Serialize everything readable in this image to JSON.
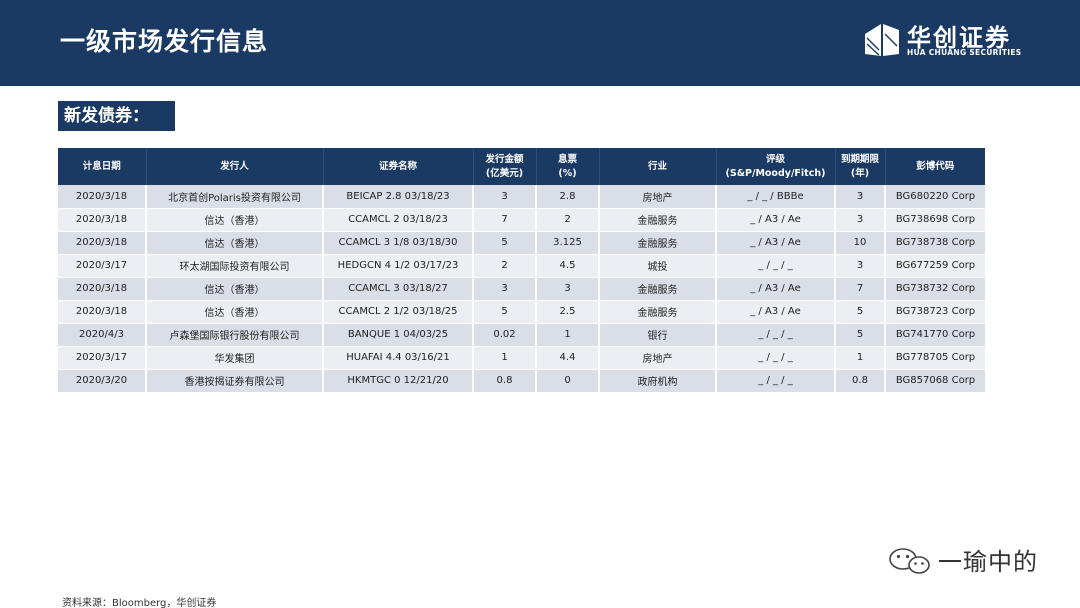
{
  "header": {
    "title": "一级市场发行信息",
    "logo_cn": "华创证券",
    "logo_en": "HUA CHUANG SECURITIES"
  },
  "section": {
    "label": "新发债券："
  },
  "table": {
    "headers": [
      [
        "计息日期"
      ],
      [
        "发行人"
      ],
      [
        "证券名称"
      ],
      [
        "发行金额",
        "(亿美元)"
      ],
      [
        "息票",
        "(%)"
      ],
      [
        "行业"
      ],
      [
        "评级",
        "(S&P/Moody/Fitch)"
      ],
      [
        "到期期限",
        "(年)"
      ],
      [
        "彭博代码"
      ]
    ],
    "rows": [
      [
        "2020/3/18",
        "北京首创Polaris投资有限公司",
        "BEICAP 2.8 03/18/23",
        "3",
        "2.8",
        "房地产",
        "_ / _ / BBBe",
        "3",
        "BG680220 Corp"
      ],
      [
        "2020/3/18",
        "信达（香港）",
        "CCAMCL 2 03/18/23",
        "7",
        "2",
        "金融服务",
        "_ / A3 / Ae",
        "3",
        "BG738698 Corp"
      ],
      [
        "2020/3/18",
        "信达（香港）",
        "CCAMCL 3 1/8 03/18/30",
        "5",
        "3.125",
        "金融服务",
        "_ / A3 / Ae",
        "10",
        "BG738738 Corp"
      ],
      [
        "2020/3/17",
        "环太湖国际投资有限公司",
        "HEDGCN 4 1/2 03/17/23",
        "2",
        "4.5",
        "城投",
        "_ / _ / _",
        "3",
        "BG677259 Corp"
      ],
      [
        "2020/3/18",
        "信达（香港）",
        "CCAMCL 3 03/18/27",
        "3",
        "3",
        "金融服务",
        "_ / A3 / Ae",
        "7",
        "BG738732 Corp"
      ],
      [
        "2020/3/18",
        "信达（香港）",
        "CCAMCL 2 1/2 03/18/25",
        "5",
        "2.5",
        "金融服务",
        "_ / A3 / Ae",
        "5",
        "BG738723 Corp"
      ],
      [
        "2020/4/3",
        "卢森堡国际银行股份有限公司",
        "BANQUE 1 04/03/25",
        "0.02",
        "1",
        "银行",
        "_ / _ / _",
        "5",
        "BG741770 Corp"
      ],
      [
        "2020/3/17",
        "华发集团",
        "HUAFAI 4.4 03/16/21",
        "1",
        "4.4",
        "房地产",
        "_ / _ / _",
        "1",
        "BG778705 Corp"
      ],
      [
        "2020/3/20",
        "香港按揭证券有限公司",
        "HKMTGC 0 12/21/20",
        "0.8",
        "0",
        "政府机构",
        "_ / _ / _",
        "0.8",
        "BG857068 Corp"
      ]
    ]
  },
  "watermark": {
    "text": "一瑜中的",
    "icon": "wechat-icon"
  },
  "footer": {
    "source": "资料来源：Bloomberg，华创证券"
  },
  "colors": {
    "navy": "#1b3a63",
    "row_a": "#d9dee7",
    "row_b": "#eceef3"
  }
}
